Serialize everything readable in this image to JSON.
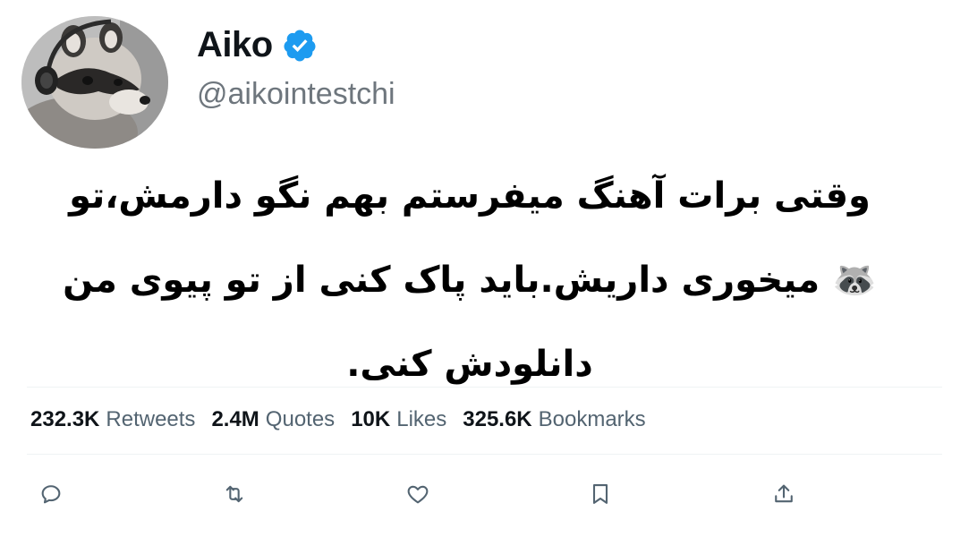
{
  "author": {
    "name": "Aiko",
    "handle": "@aikointestchi",
    "verified_color": "#1d9bf0"
  },
  "tweet": {
    "text_lines": [
      "وقتی برات آهنگ میفرستم بهم نگو دارمش،تو",
      "🦝 میخوری داریش.باید پاک کنی از تو پیوی من",
      "دانلودش کنی."
    ]
  },
  "stats": [
    {
      "value": "232.3K",
      "label": "Retweets"
    },
    {
      "value": "2.4M",
      "label": "Quotes"
    },
    {
      "value": "10K",
      "label": "Likes"
    },
    {
      "value": "325.6K",
      "label": "Bookmarks"
    }
  ],
  "actions": [
    {
      "icon": "reply-icon"
    },
    {
      "icon": "retweet-icon"
    },
    {
      "icon": "like-icon"
    },
    {
      "icon": "bookmark-icon"
    },
    {
      "icon": "share-icon"
    }
  ],
  "colors": {
    "text": "#0f1419",
    "secondary": "#536471",
    "icon": "#536471"
  }
}
